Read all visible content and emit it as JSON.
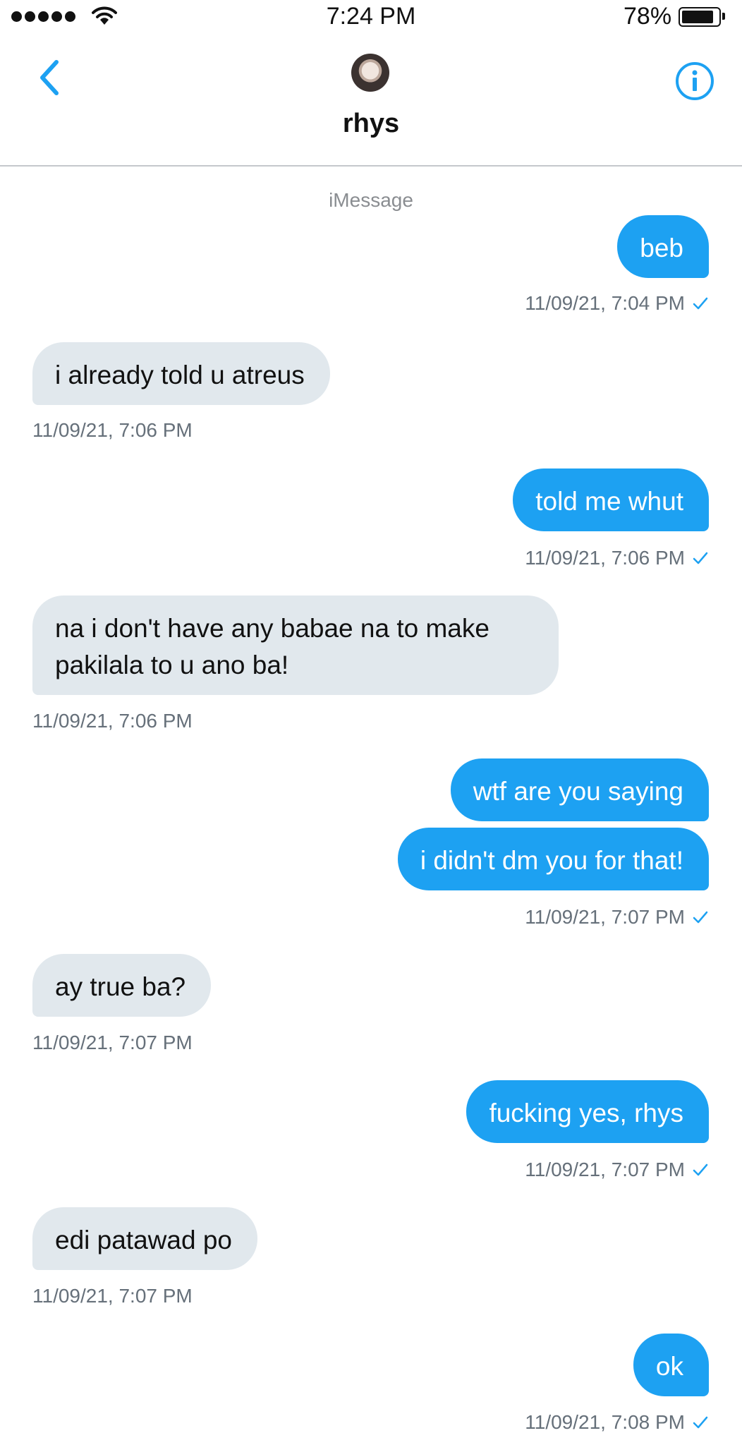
{
  "status_bar": {
    "time": "7:24 PM",
    "battery": "78%"
  },
  "header": {
    "contact_name": "rhys",
    "service": "iMessage"
  },
  "messages": [
    {
      "text": "beb",
      "time": "11/09/21, 7:04 PM"
    },
    {
      "text": "i already told u atreus",
      "time": "11/09/21, 7:06 PM"
    },
    {
      "text": "told me whut",
      "time": "11/09/21, 7:06 PM"
    },
    {
      "text": "na i don't have any babae na to make pakilala to u ano ba!",
      "time": "11/09/21, 7:06 PM"
    },
    {
      "text": "wtf are you saying"
    },
    {
      "text": "i didn't dm you for that!",
      "time": "11/09/21, 7:07 PM"
    },
    {
      "text": "ay true ba?",
      "time": "11/09/21, 7:07 PM"
    },
    {
      "text": "fucking yes, rhys",
      "time": "11/09/21, 7:07 PM"
    },
    {
      "text": "edi patawad po",
      "time": "11/09/21, 7:07 PM"
    },
    {
      "text": "ok",
      "time": "11/09/21, 7:08 PM"
    }
  ],
  "colors": {
    "outgoing_bubble": "#1da1f2",
    "incoming_bubble": "#e1e8ed",
    "accent": "#1da1f2",
    "timestamp": "#66707a"
  },
  "icons": [
    "signal-icon",
    "wifi-icon",
    "battery-icon",
    "back-chevron-icon",
    "info-icon",
    "read-check-icon"
  ]
}
